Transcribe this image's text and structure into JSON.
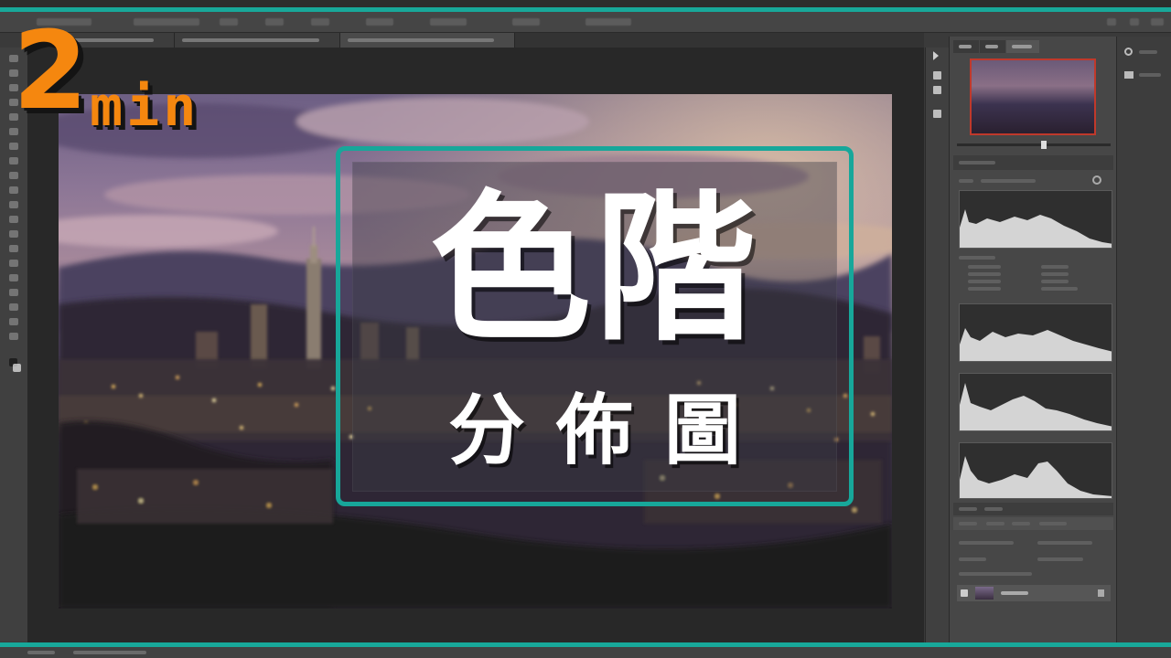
{
  "overlay": {
    "duration_number": "2",
    "duration_unit": "min",
    "title": "色階",
    "subtitle": "分佈圖"
  },
  "colors": {
    "frame_teal": "#17a79a",
    "badge_orange": "#f5870f",
    "workspace_dark": "#282828",
    "panel_gray": "#474747"
  },
  "icons": {
    "search": "search-icon",
    "workspace": "workspace-icon",
    "toggle_expand": "expand-panel-icon",
    "histogram_refresh": "refresh-icon"
  }
}
